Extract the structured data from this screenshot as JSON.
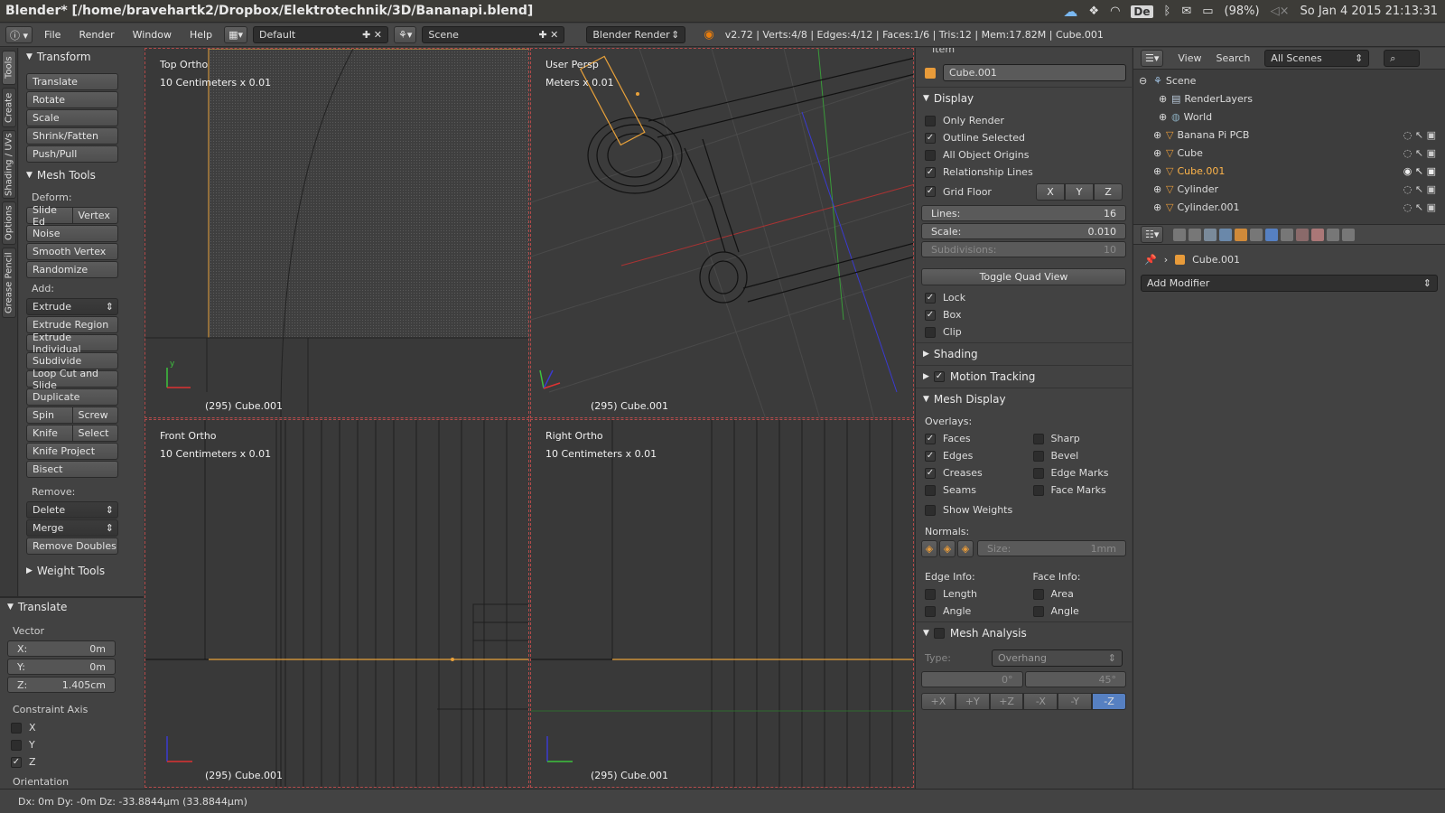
{
  "window": {
    "title": "Blender* [/home/bravehartk2/Dropbox/Elektrotechnik/3D/Bananapi.blend]"
  },
  "tray": {
    "keyboard": "De",
    "battery": "(98%)",
    "datetime": "So Jan  4 2015 21:13:31"
  },
  "menubar": {
    "menus": [
      "File",
      "Render",
      "Window",
      "Help"
    ],
    "layout": "Default",
    "scene": "Scene",
    "engine": "Blender Render",
    "stats": "v2.72 | Verts:4/8 | Edges:4/12 | Faces:1/6 | Tris:12 | Mem:17.82M | Cube.001"
  },
  "vtabs": [
    "Tools",
    "Create",
    "Shading / UVs",
    "Options",
    "Grease Pencil"
  ],
  "toolshelf": {
    "transform": {
      "title": "Transform",
      "buttons": [
        "Translate",
        "Rotate",
        "Scale",
        "Shrink/Fatten",
        "Push/Pull"
      ]
    },
    "mesh_tools": {
      "title": "Mesh Tools",
      "deform_label": "Deform:",
      "slide_edge": "Slide Ed",
      "vertex": "Vertex",
      "deform_buttons": [
        "Noise",
        "Smooth Vertex",
        "Randomize"
      ],
      "add_label": "Add:",
      "extrude": "Extrude",
      "add_buttons": [
        "Extrude Region",
        "Extrude Individual",
        "Subdivide",
        "Loop Cut and Slide",
        "Duplicate"
      ],
      "spin": "Spin",
      "screw": "Screw",
      "knife": "Knife",
      "select": "Select",
      "knife_project": "Knife Project",
      "bisect": "Bisect",
      "remove_label": "Remove:",
      "delete": "Delete",
      "merge": "Merge",
      "remove_doubles": "Remove Doubles"
    },
    "weight_tools": "Weight Tools"
  },
  "redo": {
    "title": "Translate",
    "vector_label": "Vector",
    "x_label": "X:",
    "x": "0m",
    "y_label": "Y:",
    "y": "0m",
    "z_label": "Z:",
    "z": "1.405cm",
    "constraint_label": "Constraint Axis",
    "axes": [
      {
        "label": "X",
        "on": false
      },
      {
        "label": "Y",
        "on": false
      },
      {
        "label": "Z",
        "on": true
      }
    ],
    "orientation_label": "Orientation"
  },
  "viewports": {
    "top": {
      "name": "Top Ortho",
      "scale": "10 Centimeters x 0.01",
      "object": "(295) Cube.001"
    },
    "persp": {
      "name": "User Persp",
      "scale": "Meters x 0.01",
      "object": "(295) Cube.001"
    },
    "front": {
      "name": "Front Ortho",
      "scale": "10 Centimeters x 0.01",
      "object": "(295) Cube.001"
    },
    "right": {
      "name": "Right Ortho",
      "scale": "10 Centimeters x 0.01",
      "object": "(295) Cube.001"
    }
  },
  "props": {
    "item_title": "Item",
    "object_name": "Cube.001",
    "display": {
      "title": "Display",
      "only_render": "Only Render",
      "outline_selected": "Outline Selected",
      "all_object_origins": "All Object Origins",
      "relationship_lines": "Relationship Lines",
      "grid_floor": "Grid Floor",
      "axes": [
        "X",
        "Y",
        "Z"
      ],
      "lines_label": "Lines:",
      "lines": "16",
      "scale_label": "Scale:",
      "scale": "0.010",
      "subdivisions_label": "Subdivisions:",
      "subdivisions": "10",
      "toggle_quad": "Toggle Quad View",
      "lock": "Lock",
      "box": "Box",
      "clip": "Clip"
    },
    "shading": "Shading",
    "motion_tracking": "Motion Tracking",
    "mesh_display": {
      "title": "Mesh Display",
      "overlays_label": "Overlays:",
      "faces": "Faces",
      "sharp": "Sharp",
      "edges": "Edges",
      "bevel": "Bevel",
      "creases": "Creases",
      "edge_marks": "Edge Marks",
      "seams": "Seams",
      "face_marks": "Face Marks",
      "show_weights": "Show Weights",
      "normals_label": "Normals:",
      "size_label": "Size:",
      "size": "1mm",
      "edge_info": "Edge Info:",
      "face_info": "Face Info:",
      "length": "Length",
      "area": "Area",
      "angle1": "Angle",
      "angle2": "Angle"
    },
    "mesh_analysis": {
      "title": "Mesh Analysis",
      "type_label": "Type:",
      "type": "Overhang",
      "min": "0°",
      "max": "45°",
      "axes": [
        "+X",
        "+Y",
        "+Z",
        "-X",
        "-Y",
        "-Z"
      ]
    }
  },
  "outliner": {
    "view": "View",
    "search": "Search",
    "filter": "All Scenes",
    "items": [
      "Scene",
      "RenderLayers",
      "World",
      "Banana Pi PCB",
      "Cube",
      "Cube.001",
      "Cylinder",
      "Cylinder.001"
    ]
  },
  "modifiers": {
    "object": "Cube.001",
    "add_modifier": "Add Modifier"
  },
  "status": {
    "text": "Dx: 0m   Dy: -0m  Dz: -33.8844µm (33.8844µm)"
  }
}
